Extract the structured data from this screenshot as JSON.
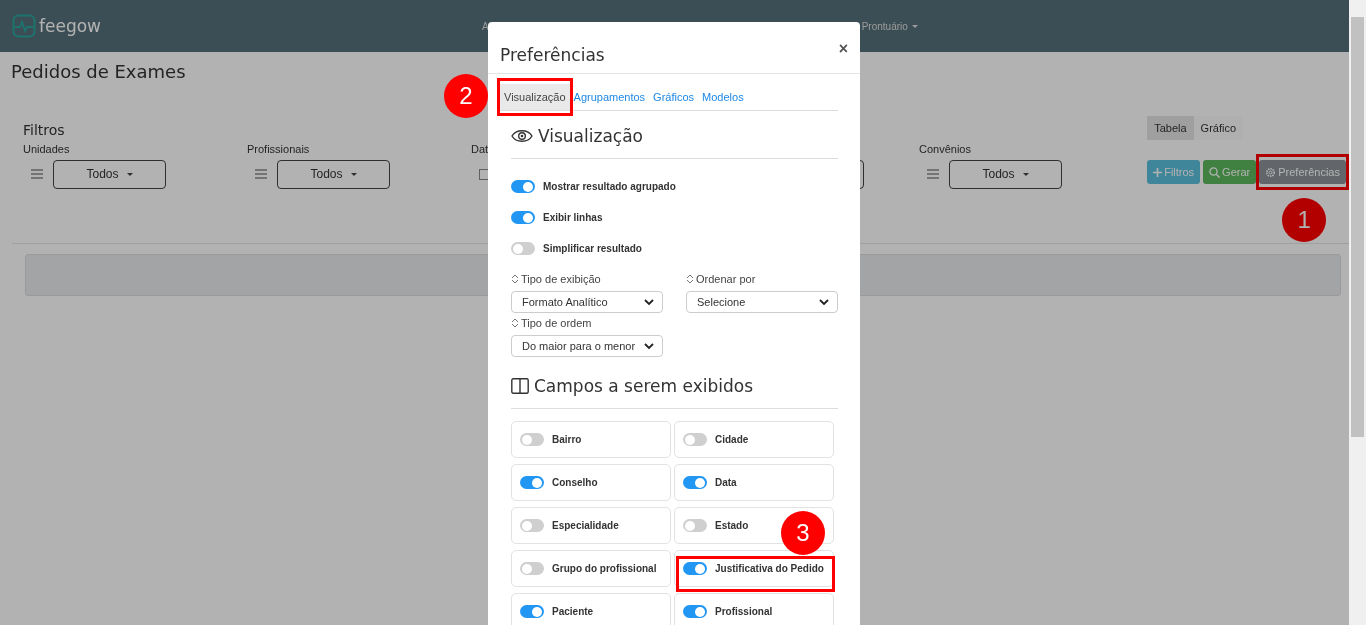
{
  "header": {
    "logo": "feegow",
    "nav": [
      {
        "label": "A",
        "dropdown": false
      },
      {
        "label": "Prontuário",
        "dropdown": true
      }
    ]
  },
  "page": {
    "title": "Pedidos de Exames"
  },
  "filters": {
    "title": "Filtros",
    "items": [
      {
        "kind": "dropdown",
        "label": "Unidades",
        "value": "Todos"
      },
      {
        "kind": "dropdown",
        "label": "Profissionais",
        "value": "Todos"
      },
      {
        "kind": "date",
        "label": "Dat"
      },
      {
        "kind": "field"
      },
      {
        "kind": "dropdown",
        "label": "Convênios",
        "value": "Todos"
      }
    ]
  },
  "view_toggle": [
    {
      "label": "Tabela",
      "selected": true
    },
    {
      "label": "Gráfico",
      "selected": false
    }
  ],
  "actions": [
    {
      "kind": "add",
      "label": "Filtros"
    },
    {
      "kind": "search",
      "label": "Gerar"
    },
    {
      "kind": "settings",
      "label": "Preferências",
      "callout": "1"
    }
  ],
  "modal": {
    "title": "Preferências",
    "close": "×",
    "tabs": [
      {
        "label": "Visualização",
        "selected": true,
        "callout": "2"
      },
      {
        "label": "Agrupamentos",
        "selected": false
      },
      {
        "label": "Gráficos",
        "selected": false
      },
      {
        "label": "Modelos",
        "selected": false
      }
    ],
    "section_title": "Visualização",
    "toggles": [
      {
        "label": "Mostrar resultado agrupado",
        "on": true
      },
      {
        "label": "Exibir linhas",
        "on": true
      },
      {
        "label": "Simplificar resultado",
        "on": false
      }
    ],
    "selects": [
      {
        "label": "Tipo de exibição",
        "value": "Formato Analítico"
      },
      {
        "label": "Ordenar por",
        "value": "Selecione"
      },
      {
        "label": "Tipo de ordem",
        "value": "Do maior para o menor"
      }
    ],
    "fields_title": "Campos a serem exibidos",
    "fields": [
      {
        "label": "Bairro",
        "on": false
      },
      {
        "label": "Cidade",
        "on": false
      },
      {
        "label": "Conselho",
        "on": true
      },
      {
        "label": "Data",
        "on": true
      },
      {
        "label": "Especialidade",
        "on": false
      },
      {
        "label": "Estado",
        "on": false
      },
      {
        "label": "Grupo do profissional",
        "on": false
      },
      {
        "label": "Justificativa do Pedido",
        "on": true,
        "callout": "3"
      },
      {
        "label": "Paciente",
        "on": true
      },
      {
        "label": "Profissional",
        "on": true
      }
    ]
  }
}
